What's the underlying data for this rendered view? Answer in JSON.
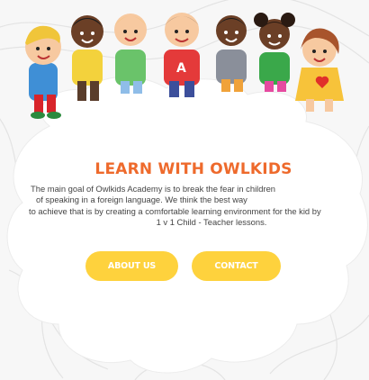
{
  "section": {
    "title": "LEARN WITH OWLKIDS",
    "description_lines": [
      "The main goal of Owlkids Academy is to break the fear in children",
      "of speaking in a foreign language. We think the best way",
      "to achieve that is by creating a comfortable learning environment for the kid by",
      "1 v 1 Child - Teacher lessons."
    ]
  },
  "buttons": {
    "about_label": "ABOUT US",
    "contact_label": "CONTACT"
  },
  "colors": {
    "title": "#ee6a2c",
    "button_bg": "#fed23d",
    "button_text": "#ffffff",
    "page_bg": "#f7f7f7",
    "card_bg": "#ffffff"
  }
}
